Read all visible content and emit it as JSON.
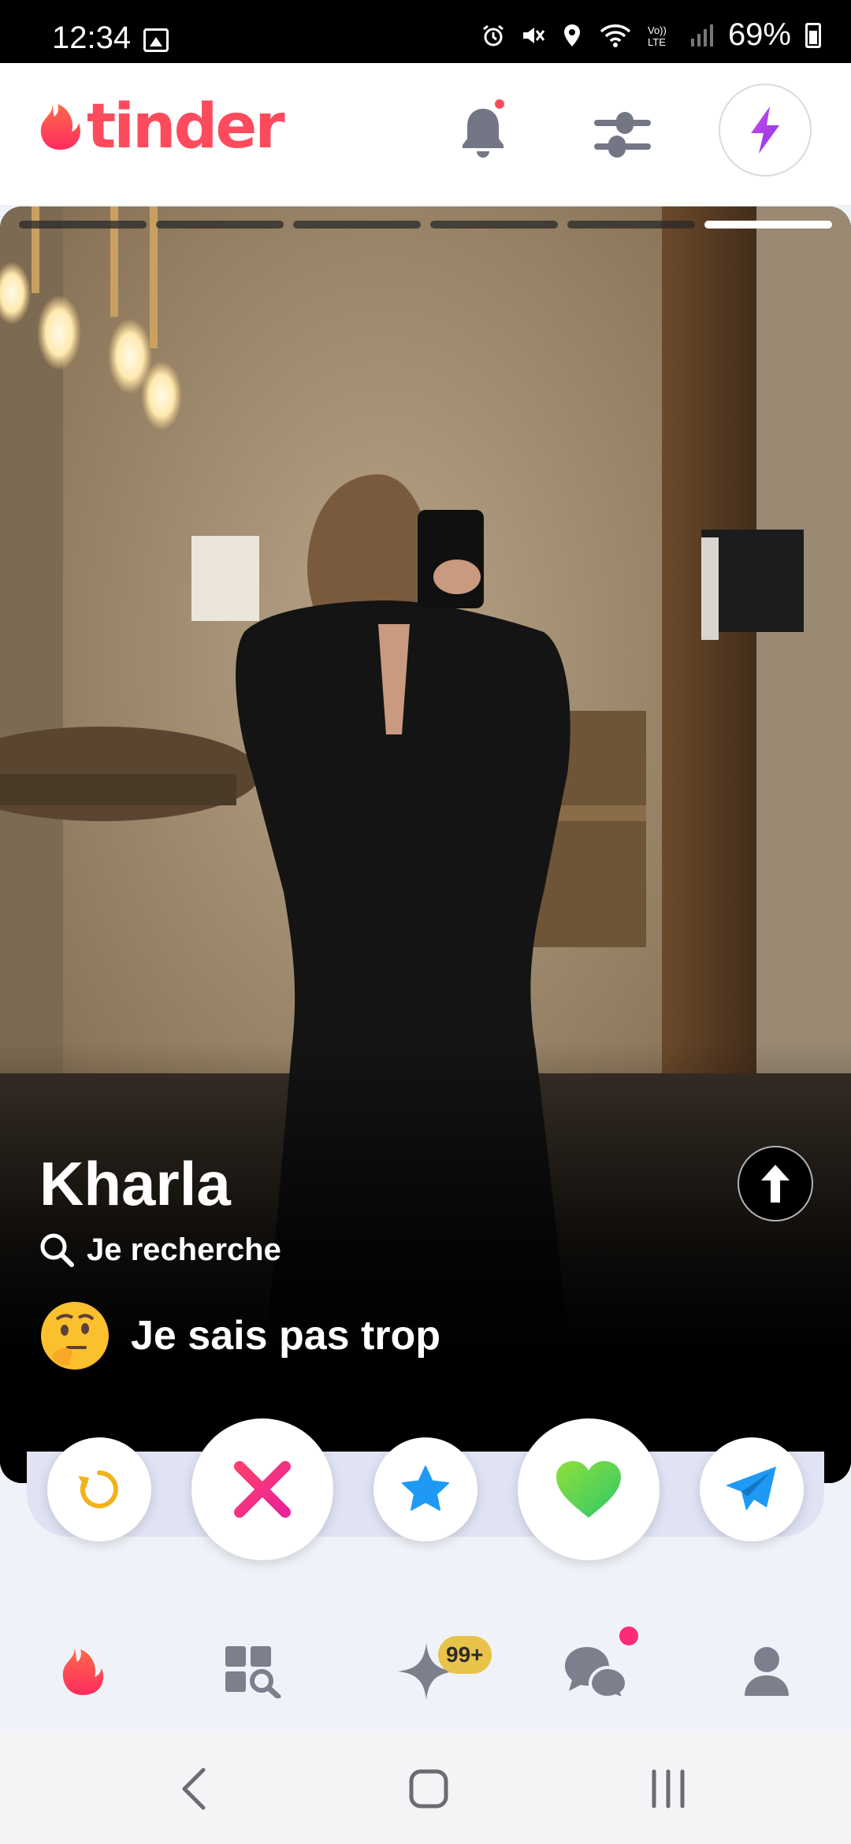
{
  "status_bar": {
    "time": "12:34",
    "battery": "69%",
    "icons": [
      "gallery-icon",
      "alarm-icon",
      "mute-icon",
      "location-icon",
      "wifi-icon",
      "volte-icon",
      "signal-icon",
      "battery-icon"
    ]
  },
  "header": {
    "logo_text": "tinder",
    "buttons": [
      "bell-icon",
      "filters-icon",
      "boost-icon"
    ],
    "accent": "#fd4b5e",
    "boost_color": "#a33ce6"
  },
  "card": {
    "photo_count": 6,
    "active_photo_index": 6,
    "name": "Kharla",
    "looking_label": "Je recherche",
    "intent_text": "Je sais pas trop",
    "intent_emoji": "thinking-face-emoji"
  },
  "actions": [
    {
      "name": "rewind",
      "icon": "rewind-icon",
      "color": "#f3b21b"
    },
    {
      "name": "nope",
      "icon": "x-icon",
      "color": "#fd267d"
    },
    {
      "name": "super-like",
      "icon": "star-icon",
      "color": "#1e9af5"
    },
    {
      "name": "like",
      "icon": "heart-icon",
      "color": "#4fd34b"
    },
    {
      "name": "send-message",
      "icon": "paper-plane-icon",
      "color": "#1e9af5"
    }
  ],
  "bottom_nav": {
    "items": [
      "flame-icon",
      "explore-icon",
      "sparkle-icon",
      "chat-icon",
      "profile-icon"
    ],
    "badge": "99+"
  },
  "system_nav": [
    "back-icon",
    "home-icon",
    "recents-icon"
  ]
}
